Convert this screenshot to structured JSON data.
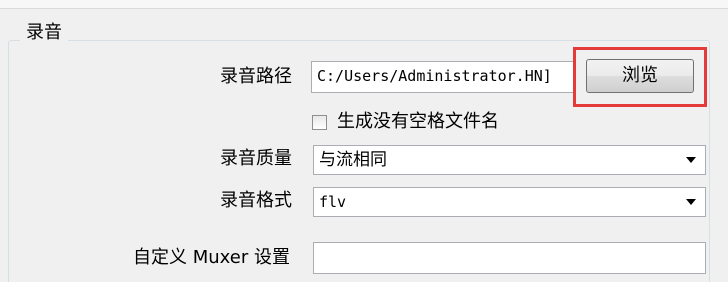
{
  "group": {
    "title": "录音"
  },
  "path": {
    "label": "录音路径",
    "value": "C:/Users/Administrator.HN]",
    "browse_label": "浏览"
  },
  "no_space_filename": {
    "label": "生成没有空格文件名",
    "checked": false
  },
  "quality": {
    "label": "录音质量",
    "selected": "与流相同"
  },
  "format": {
    "label": "录音格式",
    "selected": "flv"
  },
  "muxer": {
    "label": "自定义 Muxer 设置",
    "value": ""
  },
  "colors": {
    "highlight": "#e53a3a",
    "background": "#f0f0f0"
  }
}
